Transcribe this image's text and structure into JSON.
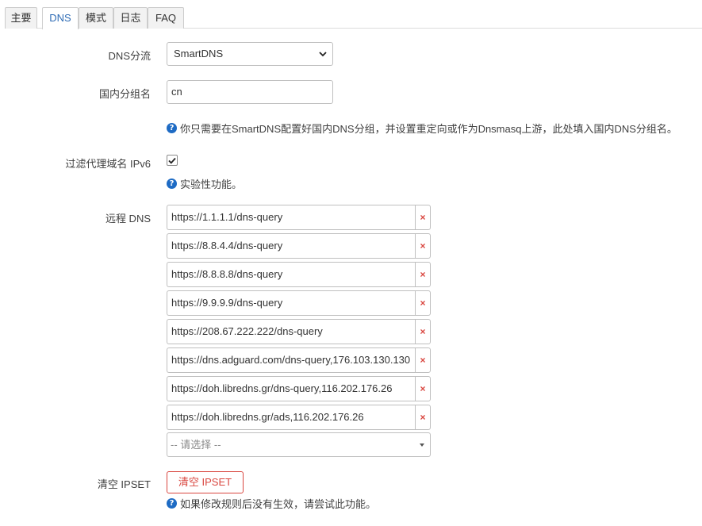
{
  "tabs": [
    {
      "label": "主要",
      "active": false
    },
    {
      "label": "DNS",
      "active": true
    },
    {
      "label": "模式",
      "active": false
    },
    {
      "label": "日志",
      "active": false
    },
    {
      "label": "FAQ",
      "active": false
    }
  ],
  "dns_split": {
    "label": "DNS分流",
    "value": "SmartDNS"
  },
  "domestic_group": {
    "label": "国内分组名",
    "value": "cn",
    "help": "你只需要在SmartDNS配置好国内DNS分组，并设置重定向或作为Dnsmasq上游，此处填入国内DNS分组名。"
  },
  "filter_ipv6": {
    "label": "过滤代理域名 IPv6",
    "checked": true,
    "help": "实验性功能。"
  },
  "remote_dns": {
    "label": "远程 DNS",
    "entries": [
      "https://1.1.1.1/dns-query",
      "https://8.8.4.4/dns-query",
      "https://8.8.8.8/dns-query",
      "https://9.9.9.9/dns-query",
      "https://208.67.222.222/dns-query",
      "https://dns.adguard.com/dns-query,176.103.130.130",
      "https://doh.libredns.gr/dns-query,116.202.176.26",
      "https://doh.libredns.gr/ads,116.202.176.26"
    ],
    "remove_symbol": "×",
    "add_placeholder": "-- 请选择 --"
  },
  "clear_ipset": {
    "label": "清空 IPSET",
    "button": "清空 IPSET",
    "help": "如果修改规则后没有生效，请尝试此功能。"
  },
  "colors": {
    "accent": "#2f6cb5",
    "danger": "#d9463f",
    "help_icon": "#1e6bc4"
  }
}
